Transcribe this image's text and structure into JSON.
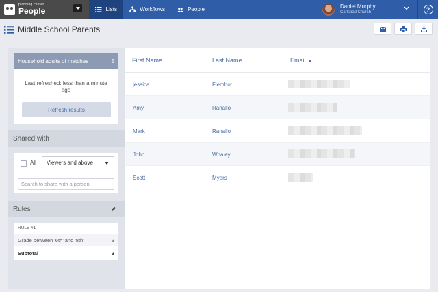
{
  "brand": {
    "small": "planning center",
    "name": "People"
  },
  "nav": {
    "tabs": [
      {
        "label": "Lists",
        "icon": "list-icon"
      },
      {
        "label": "Workflows",
        "icon": "workflow-icon"
      },
      {
        "label": "People",
        "icon": "people-icon"
      }
    ],
    "active": "Lists"
  },
  "user": {
    "name": "Daniel Murphy",
    "org": "Carlsbad Church"
  },
  "help_label": "?",
  "page": {
    "title": "Middle School Parents"
  },
  "header_actions": [
    "email-icon",
    "print-icon",
    "download-icon"
  ],
  "sidebar": {
    "matches_label": "Household adults of matches",
    "matches_count": "5",
    "refresh_text": "Last refreshed: less than a minute ago",
    "refresh_button": "Refresh results",
    "shared_heading": "Shared with",
    "all_label": "All",
    "viewers_select": "Viewers and above",
    "share_placeholder": "Search to share with a person",
    "rules_heading": "Rules",
    "rule_label": "RULE #1",
    "rule_text": "Grade between '6th' and '8th'",
    "rule_count": "3",
    "subtotal_label": "Subtotal",
    "subtotal_count": "3"
  },
  "table": {
    "columns": [
      "First Name",
      "Last Name",
      "Email"
    ],
    "sorted_by": "Email",
    "rows": [
      {
        "first": "jessica",
        "last": "Flembot"
      },
      {
        "first": "Amy",
        "last": "Ranallo"
      },
      {
        "first": "Mark",
        "last": "Ranallo"
      },
      {
        "first": "John",
        "last": "Whaley"
      },
      {
        "first": "Scott",
        "last": "Myers"
      }
    ]
  },
  "colors": {
    "nav": "#2f5da8",
    "nav_active": "#1e437f",
    "brand_bg": "#4a4a4a",
    "accent": "#4a6ea8",
    "matches_bg": "#8c9bb3"
  }
}
